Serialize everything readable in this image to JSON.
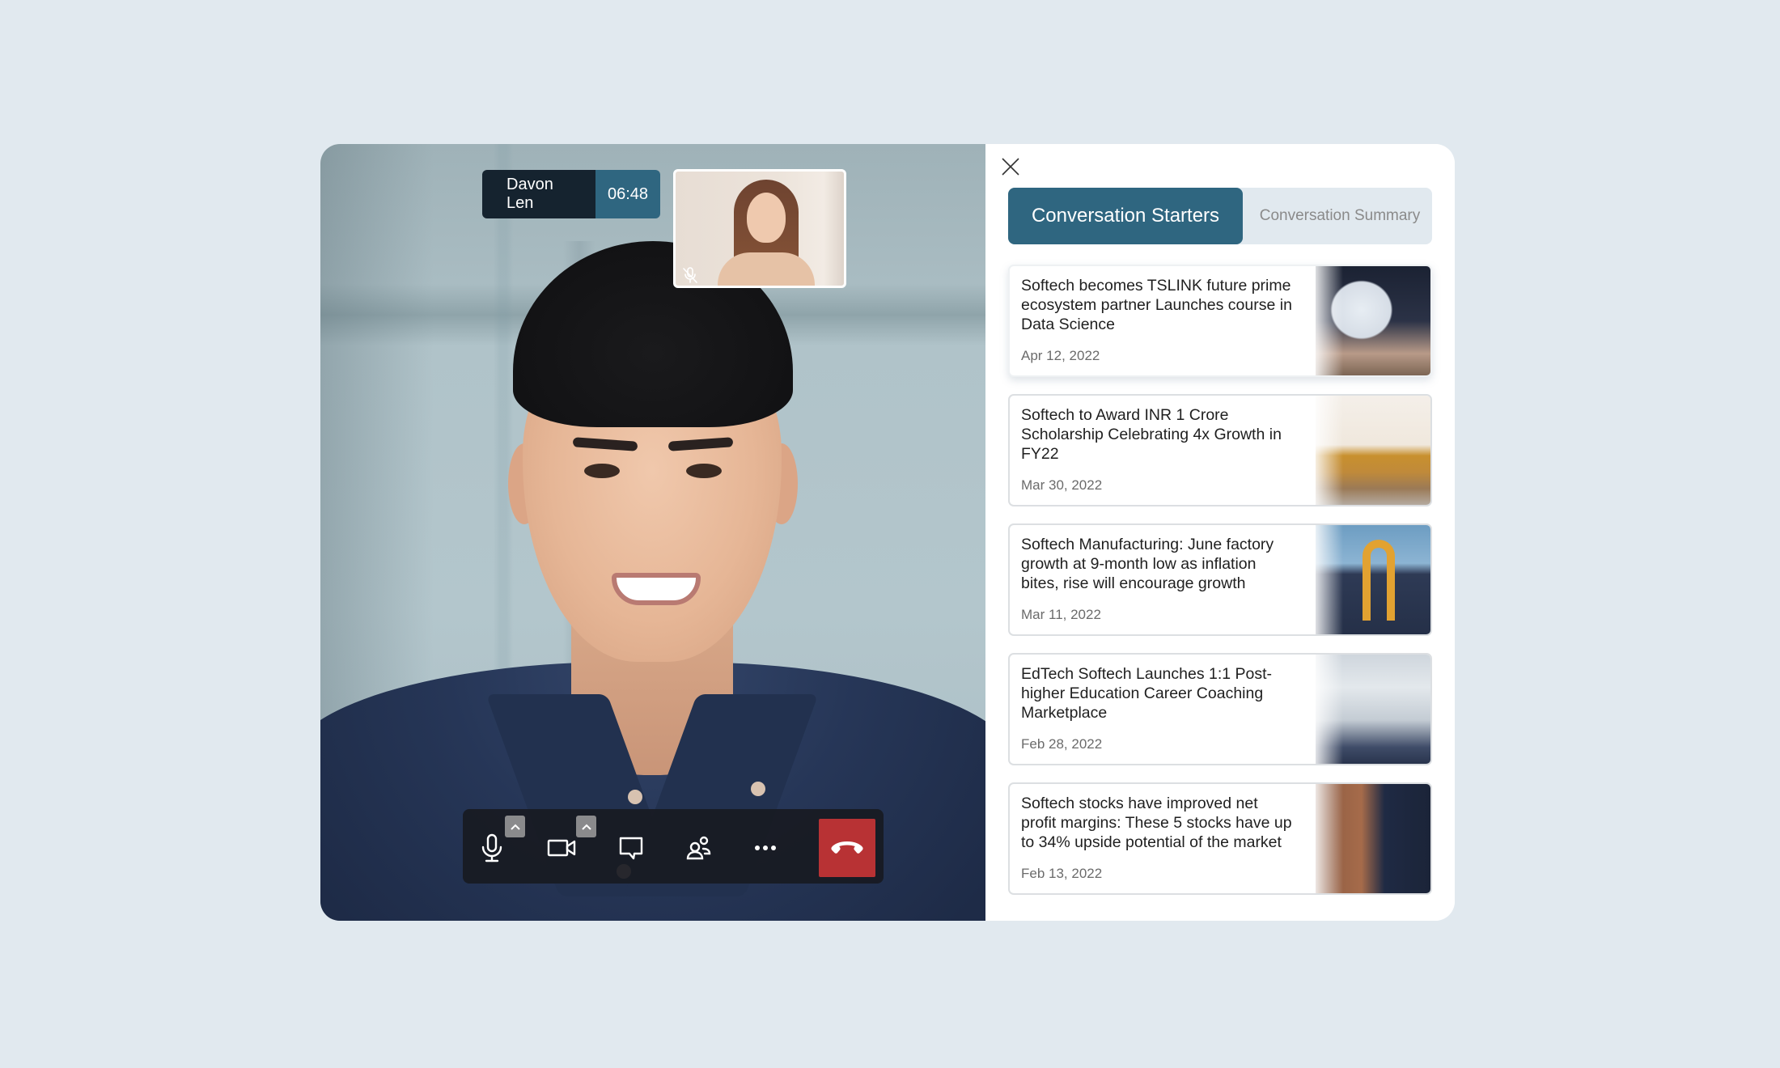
{
  "call": {
    "participant_name": "Davon Len",
    "duration": "06:48",
    "self_view": {
      "mic_status": "muted"
    }
  },
  "controls": {
    "items": [
      {
        "id": "microphone",
        "icon": "microphone-icon",
        "has_options": true
      },
      {
        "id": "camera",
        "icon": "video-camera-icon",
        "has_options": true
      },
      {
        "id": "chat",
        "icon": "chat-bubble-icon",
        "has_options": false
      },
      {
        "id": "participants",
        "icon": "participants-icon",
        "has_options": false
      },
      {
        "id": "more",
        "icon": "more-horizontal-icon",
        "has_options": false
      },
      {
        "id": "end_call",
        "icon": "hang-up-icon",
        "has_options": false
      }
    ],
    "end_call_color": "#b83234"
  },
  "panel": {
    "close_icon": "close-icon",
    "tabs": [
      {
        "label": "Conversation Starters",
        "active": true
      },
      {
        "label": "Conversation Summary",
        "active": false
      }
    ],
    "accent_color": "#2f6680"
  },
  "news": [
    {
      "title": "Softech becomes TSLINK future prime ecosystem partner Launches course in Data Science",
      "date": "Apr 12, 2022",
      "thumbnail": "laptop-analytics-photo"
    },
    {
      "title": "Softech to Award INR 1 Crore Scholarship Celebrating 4x Growth in FY22",
      "date": "Mar 30, 2022",
      "thumbnail": "office-meeting-photo"
    },
    {
      "title": "Softech Manufacturing: June factory growth at 9-month low as inflation bites, rise will encourage growth",
      "date": "Mar 11, 2022",
      "thumbnail": "factory-building-photo"
    },
    {
      "title": "EdTech Softech Launches 1:1 Post-higher Education Career Coaching Marketplace",
      "date": "Feb 28, 2022",
      "thumbnail": "graduation-caps-photo"
    },
    {
      "title": "Softech stocks have improved net profit margins: These 5 stocks have up to 34% upside potential of the market",
      "date": "Feb 13, 2022",
      "thumbnail": "man-video-call-photo"
    }
  ]
}
